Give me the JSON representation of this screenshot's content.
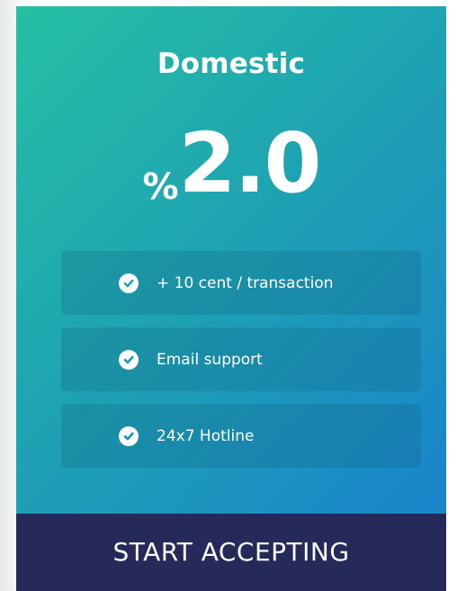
{
  "plan": {
    "title": "Domestic",
    "price_symbol": "%",
    "price_value": "2.0",
    "features": [
      {
        "label": "+ 10 cent / transaction",
        "icon": "check-circle-icon"
      },
      {
        "label": "Email support",
        "icon": "check-circle-icon"
      },
      {
        "label": "24x7 Hotline",
        "icon": "check-circle-icon"
      }
    ],
    "cta_label": "START ACCEPTING"
  },
  "colors": {
    "gradient_start": "#25c0a3",
    "gradient_end": "#187fcf",
    "cta_background": "#252a5a",
    "text": "#ffffff"
  }
}
